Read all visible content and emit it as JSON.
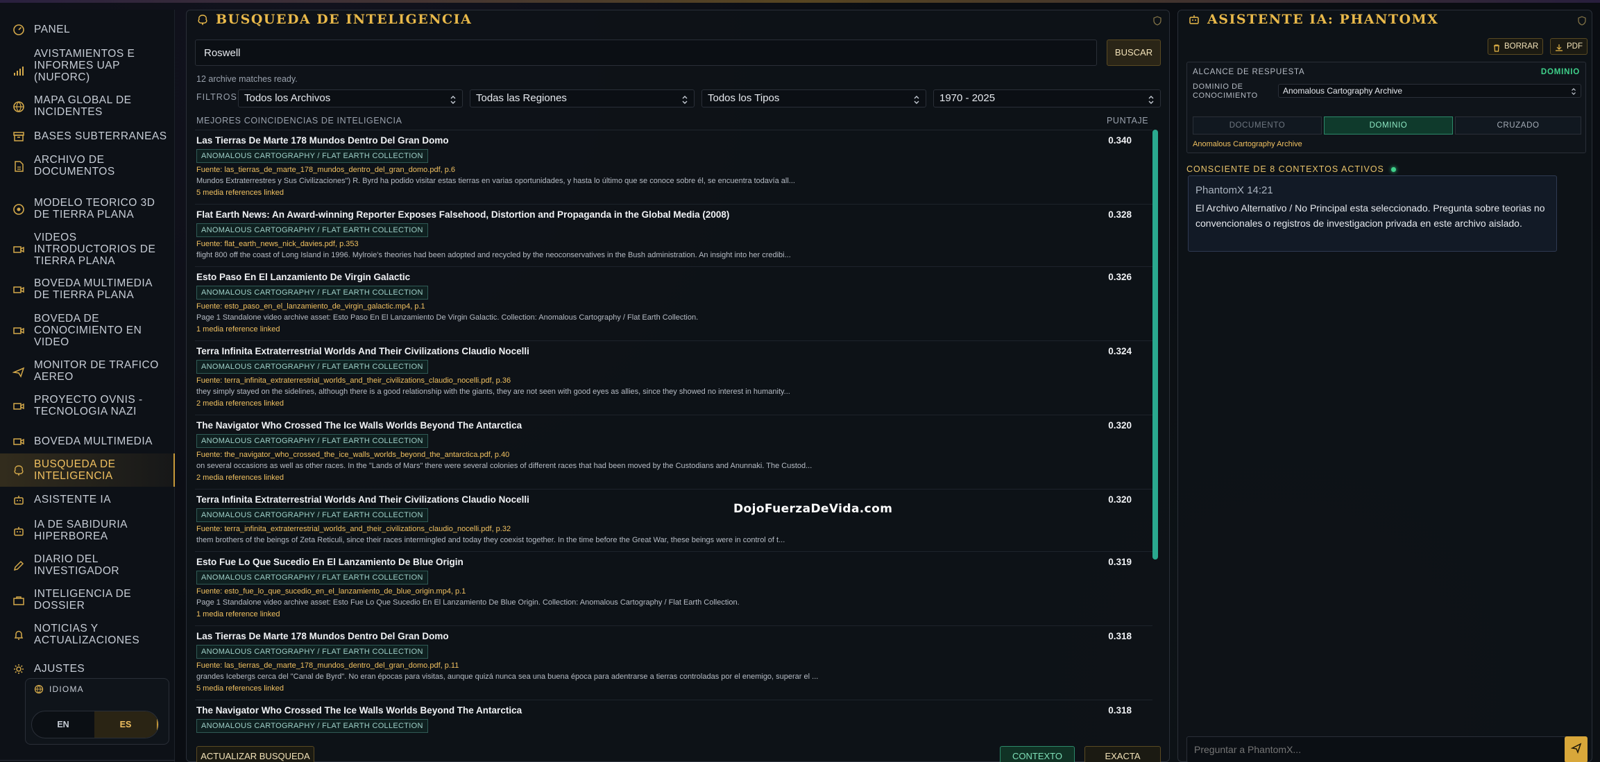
{
  "sidebar": {
    "items": [
      {
        "label": "PANEL",
        "icon": "gauge-icon"
      },
      {
        "label": "AVISTAMIENTOS E INFORMES UAP (NUFORC)",
        "icon": "signal-bars-icon"
      },
      {
        "label": "MAPA GLOBAL DE INCIDENTES",
        "icon": "globe-icon"
      },
      {
        "label": "BASES SUBTERRANEAS",
        "icon": "archive-box-icon"
      },
      {
        "label": "ARCHIVO DE DOCUMENTOS",
        "icon": "document-icon"
      },
      {
        "label": "MODELO TEORICO 3D DE TIERRA PLANA",
        "icon": "orbit-icon"
      },
      {
        "label": "VIDEOS INTRODUCTORIOS DE TIERRA PLANA",
        "icon": "video-camera-icon"
      },
      {
        "label": "BOVEDA MULTIMEDIA DE TIERRA PLANA",
        "icon": "video-camera-icon"
      },
      {
        "label": "BOVEDA DE CONOCIMIENTO EN VIDEO",
        "icon": "video-camera-icon"
      },
      {
        "label": "MONITOR DE TRAFICO AEREO",
        "icon": "airplane-icon"
      },
      {
        "label": "PROYECTO OVNIS - TECNOLOGIA NAZI",
        "icon": "video-camera-icon"
      },
      {
        "label": "BOVEDA MULTIMEDIA",
        "icon": "video-camera-icon"
      },
      {
        "label": "BUSQUEDA DE INTELIGENCIA",
        "icon": "brain-icon"
      },
      {
        "label": "ASISTENTE IA",
        "icon": "robot-icon"
      },
      {
        "label": "IA DE SABIDURIA HIPERBOREA",
        "icon": "robot-icon"
      },
      {
        "label": "DIARIO DEL INVESTIGADOR",
        "icon": "edit-icon"
      },
      {
        "label": "INTELIGENCIA DE DOSSIER",
        "icon": "briefcase-icon"
      },
      {
        "label": "NOTICIAS Y ACTUALIZACIONES",
        "icon": "bell-icon"
      },
      {
        "label": "AJUSTES",
        "icon": "gear-icon"
      }
    ],
    "language": {
      "title": "IDIOMA",
      "options": [
        "EN",
        "ES"
      ],
      "selected": "ES"
    }
  },
  "search": {
    "title": "BUSQUEDA DE INTELIGENCIA",
    "query": "Roswell",
    "button": "BUSCAR",
    "status": "12 archive matches ready.",
    "filters_label": "FILTROS",
    "filters": [
      "Todos los Archivos",
      "Todas las Regiones",
      "Todos los Tipos",
      "1970 - 2025"
    ],
    "list_header": "MEJORES COINCIDENCIAS DE INTELIGENCIA",
    "score_header": "PUNTAJE",
    "results": [
      {
        "title": "Las Tierras De Marte 178 Mundos Dentro Del Gran Domo",
        "score": "0.340",
        "tag": "ANOMALOUS CARTOGRAPHY / FLAT EARTH COLLECTION",
        "source": "Fuente: las_tierras_de_marte_178_mundos_dentro_del_gran_domo.pdf, p.6",
        "snippet": "Mundos Extraterrestres y Sus Civilizaciones\") R. Byrd ha podido visitar estas tierras en varias oportunidades, y hasta lo último que se conoce sobre él, se encuentra todavía all...",
        "media": "5 media references linked"
      },
      {
        "title": "Flat Earth News: An Award-winning Reporter Exposes Falsehood, Distortion and Propaganda in the Global Media (2008)",
        "score": "0.328",
        "tag": "ANOMALOUS CARTOGRAPHY / FLAT EARTH COLLECTION",
        "source": "Fuente: flat_earth_news_nick_davies.pdf, p.353",
        "snippet": "flight 800 off the coast of Long Island in 1996. Mylroie's theories had been adopted and recycled by the neoconservatives in the Bush administration. An insight into her credibi...",
        "media": ""
      },
      {
        "title": "Esto Paso En El Lanzamiento De Virgin Galactic",
        "score": "0.326",
        "tag": "ANOMALOUS CARTOGRAPHY / FLAT EARTH COLLECTION",
        "source": "Fuente: esto_paso_en_el_lanzamiento_de_virgin_galactic.mp4, p.1",
        "snippet": "Page 1 Standalone video archive asset: Esto Paso En El Lanzamiento De Virgin Galactic. Collection: Anomalous Cartography / Flat Earth Collection.",
        "media": "1 media reference linked"
      },
      {
        "title": "Terra Infinita Extraterrestrial Worlds And Their Civilizations Claudio Nocelli",
        "score": "0.324",
        "tag": "ANOMALOUS CARTOGRAPHY / FLAT EARTH COLLECTION",
        "source": "Fuente: terra_infinita_extraterrestrial_worlds_and_their_civilizations_claudio_nocelli.pdf, p.36",
        "snippet": "they simply stayed on the sidelines, although there is a good relationship with the giants, they are not seen with good eyes as allies, since they showed no interest in humanity...",
        "media": "2 media references linked"
      },
      {
        "title": "The Navigator Who Crossed The Ice Walls Worlds Beyond The Antarctica",
        "score": "0.320",
        "tag": "ANOMALOUS CARTOGRAPHY / FLAT EARTH COLLECTION",
        "source": "Fuente: the_navigator_who_crossed_the_ice_walls_worlds_beyond_the_antarctica.pdf, p.40",
        "snippet": "on several occasions as well as other races. In the \"Lands of Mars\" there were several colonies of different races that had been moved by the Custodians and Anunnaki. The Custod...",
        "media": "2 media references linked"
      },
      {
        "title": "Terra Infinita Extraterrestrial Worlds And Their Civilizations Claudio Nocelli",
        "score": "0.320",
        "tag": "ANOMALOUS CARTOGRAPHY / FLAT EARTH COLLECTION",
        "source": "Fuente: terra_infinita_extraterrestrial_worlds_and_their_civilizations_claudio_nocelli.pdf, p.32",
        "snippet": "them brothers of the beings of Zeta Reticuli, since their races intermingled and today they coexist together. In the time before the Great War, these beings were in control of t...",
        "media": ""
      },
      {
        "title": "Esto Fue Lo Que Sucedio En El Lanzamiento De Blue Origin",
        "score": "0.319",
        "tag": "ANOMALOUS CARTOGRAPHY / FLAT EARTH COLLECTION",
        "source": "Fuente: esto_fue_lo_que_sucedio_en_el_lanzamiento_de_blue_origin.mp4, p.1",
        "snippet": "Page 1 Standalone video archive asset: Esto Fue Lo Que Sucedio En El Lanzamiento De Blue Origin. Collection: Anomalous Cartography / Flat Earth Collection.",
        "media": "1 media reference linked"
      },
      {
        "title": "Las Tierras De Marte 178 Mundos Dentro Del Gran Domo",
        "score": "0.318",
        "tag": "ANOMALOUS CARTOGRAPHY / FLAT EARTH COLLECTION",
        "source": "Fuente: las_tierras_de_marte_178_mundos_dentro_del_gran_domo.pdf, p.11",
        "snippet": "grandes Icebergs cerca del \"Canal de Byrd\". No eran épocas para visitas, aunque quizá nunca sea una buena época para adentrarse a tierras controladas por el enemigo, superar el ...",
        "media": "5 media references linked"
      },
      {
        "title": "The Navigator Who Crossed The Ice Walls Worlds Beyond The Antarctica",
        "score": "0.318",
        "tag": "ANOMALOUS CARTOGRAPHY / FLAT EARTH COLLECTION",
        "source": "",
        "snippet": "",
        "media": ""
      }
    ],
    "refresh_button": "ACTUALIZAR BUSQUEDA",
    "context_button": "CONTEXTO",
    "exact_button": "EXACTA",
    "watermark": "DojoFuerzaDeVida.com"
  },
  "assistant": {
    "title": "ASISTENTE IA: PHANTOMX",
    "clear_button": "BORRAR",
    "pdf_button": "PDF",
    "scope_label": "ALCANCE DE RESPUESTA",
    "scope_value": "DOMINIO",
    "domain_label": "DOMINIO DE CONOCIMIENTO",
    "domain_value": "Anomalous Cartography Archive",
    "segments": [
      "DOCUMENTO",
      "DOMINIO",
      "CRUZADO"
    ],
    "selected_segment": "DOMINIO",
    "scope_note": "Anomalous Cartography Archive",
    "contexts": "CONSCIENTE DE 8 CONTEXTOS ACTIVOS",
    "message": {
      "header": "PhantomX 14:21",
      "body": "El Archivo Alternativo / No Principal esta seleccionado. Pregunta sobre teorias no convencionales o registros de investigacion privada en este archivo aislado."
    },
    "input_placeholder": "Preguntar a PhantomX..."
  },
  "colors": {
    "accent_gold": "#e9b94a",
    "accent_green": "#3fd08a",
    "background": "#0a0d12"
  }
}
